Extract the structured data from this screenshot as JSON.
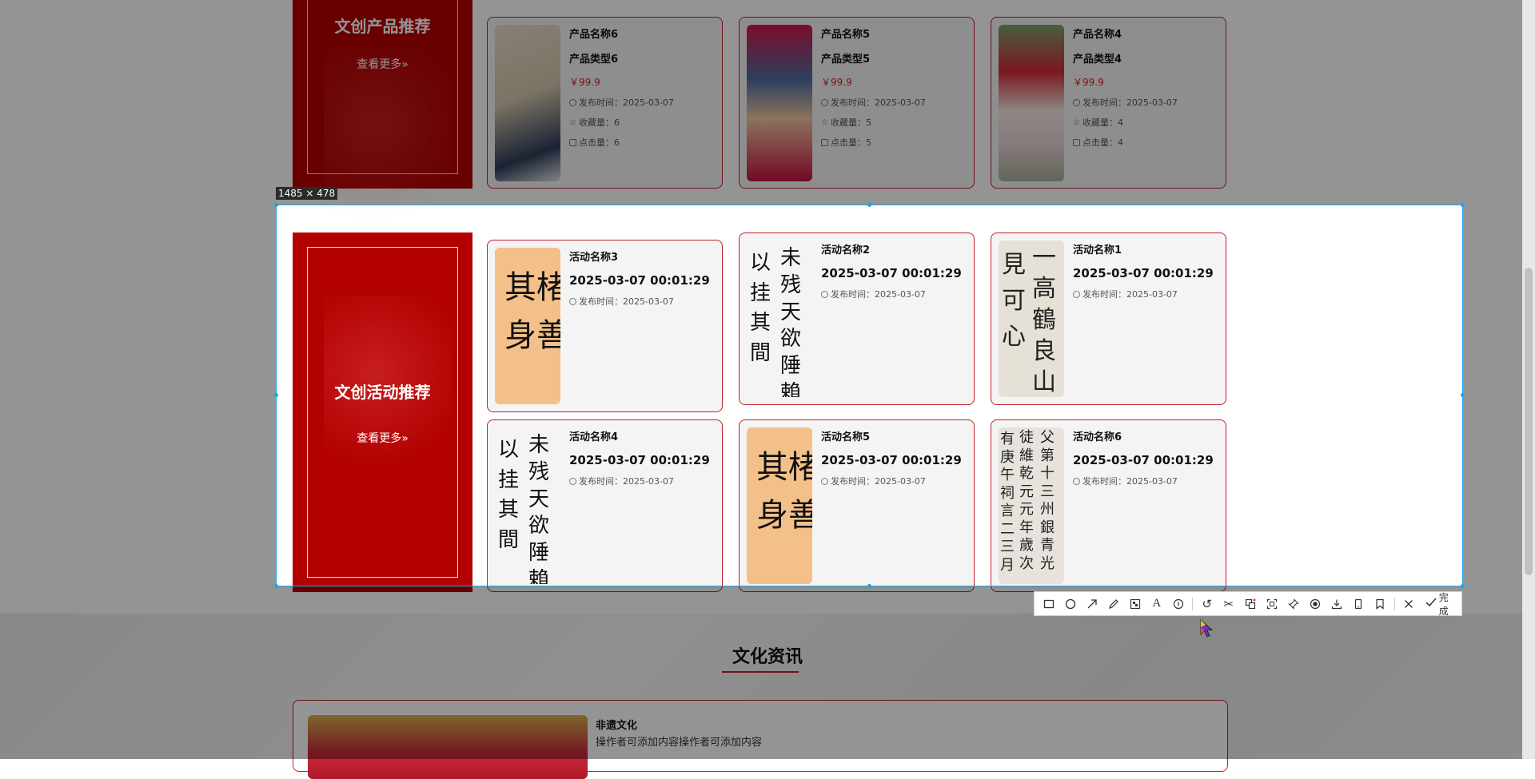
{
  "products": {
    "promo_title": "文创产品推荐",
    "more_label": "查看更多»",
    "items": [
      {
        "name": "产品名称6",
        "type": "产品类型6",
        "price": "￥99.9",
        "publish": "发布时间：2025-03-07",
        "favorites": "收藏量：6",
        "clicks": "点击量：6"
      },
      {
        "name": "产品名称5",
        "type": "产品类型5",
        "price": "￥99.9",
        "publish": "发布时间：2025-03-07",
        "favorites": "收藏量：5",
        "clicks": "点击量：5"
      },
      {
        "name": "产品名称4",
        "type": "产品类型4",
        "price": "￥99.9",
        "publish": "发布时间：2025-03-07",
        "favorites": "收藏量：4",
        "clicks": "点击量：4"
      }
    ]
  },
  "activities": {
    "promo_title": "文创活动推荐",
    "more_label": "查看更多»",
    "items": [
      {
        "name": "活动名称3",
        "datetime": "2025-03-07 00:01:29",
        "publish": "发布时间：2025-03-07",
        "image": "orange-calligraphy"
      },
      {
        "name": "活动名称2",
        "datetime": "2025-03-07 00:01:29",
        "publish": "发布时间：2025-03-07",
        "image": "black-calligraphy"
      },
      {
        "name": "活动名称1",
        "datetime": "2025-03-07 00:01:29",
        "publish": "发布时间：2025-03-07",
        "image": "grey-calligraphy"
      },
      {
        "name": "活动名称4",
        "datetime": "2025-03-07 00:01:29",
        "publish": "发布时间：2025-03-07",
        "image": "black-calligraphy"
      },
      {
        "name": "活动名称5",
        "datetime": "2025-03-07 00:01:29",
        "publish": "发布时间：2025-03-07",
        "image": "orange-calligraphy"
      },
      {
        "name": "活动名称6",
        "datetime": "2025-03-07 00:01:29",
        "publish": "发布时间：2025-03-07",
        "image": "grey-calligraphy"
      }
    ]
  },
  "screenshot_tool": {
    "size_label": "1485 × 478",
    "done_label": "完成",
    "tools": [
      "rectangle-icon",
      "ellipse-icon",
      "arrow-icon",
      "pencil-icon",
      "mosaic-icon",
      "text-icon",
      "number-icon",
      "undo-icon",
      "scissors-icon",
      "translate-icon",
      "ocr-icon",
      "pin-icon",
      "record-icon",
      "download-icon",
      "phone-icon",
      "bookmark-icon",
      "close-icon"
    ],
    "accent": "#1fa3e6"
  },
  "news": {
    "section_title": "文化资讯",
    "item_title": "非遗文化",
    "item_desc": "操作者可添加内容操作者可添加内容"
  },
  "colors": {
    "brand_red": "#b30000",
    "border_red": "#c0202c",
    "price_red": "#d01e24"
  }
}
